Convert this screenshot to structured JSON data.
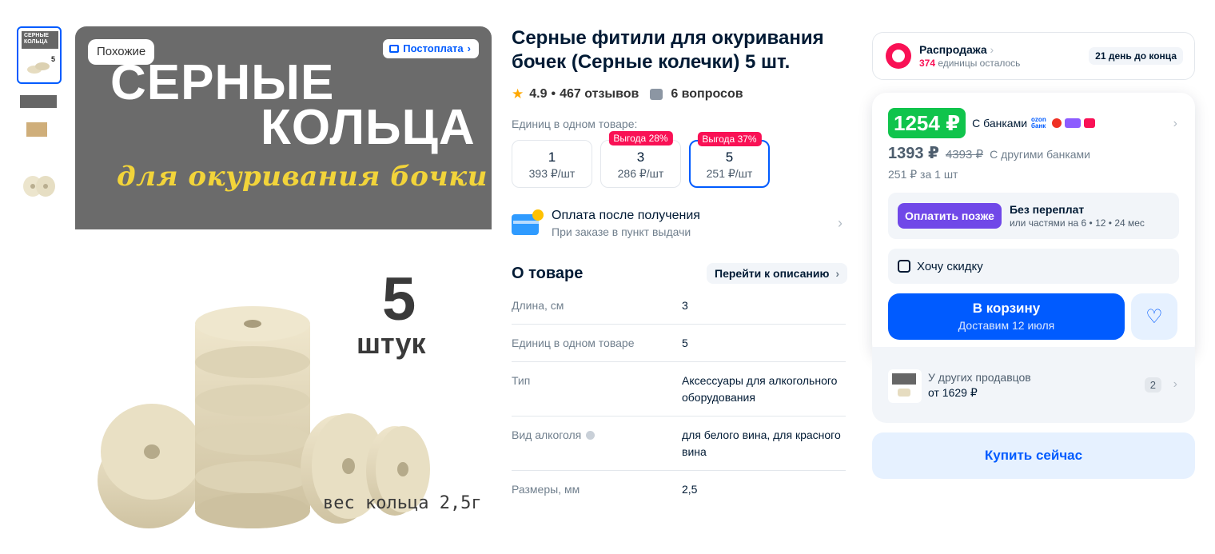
{
  "gallery": {
    "thumb_label": "СЕРНЫЕ КОЛЬЦА",
    "thumb_count": "5",
    "similar_label": "Похожие",
    "postpay_label": "Постоплата",
    "banner_line1": "СЕРНЫЕ",
    "banner_line2": "КОЛЬЦА",
    "banner_script": "для окуривания бочки",
    "photo_count": "5",
    "photo_unit": "штук",
    "photo_weight": "вес кольца 2,5г"
  },
  "product": {
    "title": "Серные фитили для окуривания бочек (Серные колечки) 5 шт.",
    "rating": "4.9",
    "reviews": "467 отзывов",
    "questions": "6 вопросов",
    "units_label": "Единиц в одном товаре:",
    "options": [
      {
        "qty": "1",
        "per_unit": "393 ₽/шт",
        "badge": ""
      },
      {
        "qty": "3",
        "per_unit": "286 ₽/шт",
        "badge": "Выгода 28%"
      },
      {
        "qty": "5",
        "per_unit": "251 ₽/шт",
        "badge": "Выгода 37%"
      }
    ],
    "payment_title": "Оплата после получения",
    "payment_sub": "При заказе в пункт выдачи"
  },
  "about": {
    "title": "О товаре",
    "to_description": "Перейти к описанию",
    "specs": [
      {
        "key": "Длина, см",
        "value": "3"
      },
      {
        "key": "Единиц в одном товаре",
        "value": "5"
      },
      {
        "key": "Тип",
        "value": "Аксессуары для алкогольного оборудования"
      },
      {
        "key": "Вид алкоголя",
        "value": "для белого вина, для красного вина"
      },
      {
        "key": "Размеры, мм",
        "value": "2,5"
      }
    ]
  },
  "sale": {
    "title": "Распродажа",
    "left_count": "374",
    "left_text": "единицы осталось",
    "days_left": "21 день до конца"
  },
  "price": {
    "bank_price": "1254 ₽",
    "bank_label": "С банками",
    "bank_ozon": "ozon банк",
    "regular_price": "1393 ₽",
    "old_price": "4393 ₽",
    "other_banks": "С другими банками",
    "per_unit": "251 ₽ за 1 шт",
    "pay_later_button": "Оплатить позже",
    "pay_later_title": "Без переплат",
    "pay_later_sub": "или частями на 6 • 12 • 24 мес",
    "want_discount": "Хочу скидку",
    "cart_label": "В корзину",
    "cart_delivery": "Доставим 12 июля"
  },
  "others": {
    "title": "У других продавцов",
    "price": "от 1629 ₽",
    "count": "2"
  },
  "buy_now": "Купить сейчас",
  "colors": {
    "accent": "#005bff",
    "green": "#10c44c",
    "sale_pink": "#f91155",
    "pay_later": "#7048e8"
  }
}
